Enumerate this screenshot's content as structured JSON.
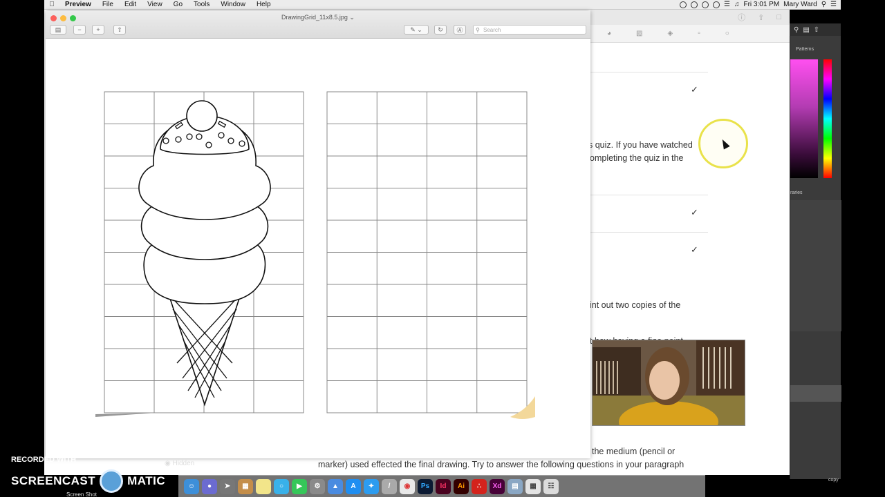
{
  "menubar": {
    "app_name": "Preview",
    "items": [
      "File",
      "Edit",
      "View",
      "Go",
      "Tools",
      "Window",
      "Help"
    ],
    "clock": "Fri 3:01 PM",
    "user": "Mary Ward"
  },
  "preview": {
    "title": "DrawingGrid_11x8.5.jpg",
    "search_placeholder": "Search"
  },
  "page_text": {
    "line1": "s quiz. If you have watched",
    "line2": "ompleting the quiz in the",
    "line3": "int out two copies of the",
    "line4": "t how having a fine point",
    "line5": "the medium (pencil or",
    "line6": "marker) used effected the final drawing. Try to answer the following questions in your paragraph"
  },
  "right_panel": {
    "patterns_label": "Patterns",
    "libraries_label": "raries"
  },
  "overlay": {
    "hidden_label": "Hidden",
    "recorded_with": "RECORDED WITH",
    "screencast_left": "SCREENCAST",
    "screencast_right": "MATIC",
    "screenshot_label": "Screen Shot",
    "copy_label": "copy"
  },
  "dock_apps": [
    "Finder",
    "Launchpad",
    "Rocket",
    "Notes",
    "Stickies",
    "Messages",
    "FaceTime",
    "Preferences",
    "Keynote",
    "App Store",
    "Safari",
    "Pencil",
    "Chrome",
    "Photoshop",
    "InDesign",
    "Illustrator",
    "Acrobat",
    "XD",
    "Preview",
    "Finder2",
    "Trash"
  ],
  "grid": {
    "columns": 4,
    "rows": 10
  }
}
